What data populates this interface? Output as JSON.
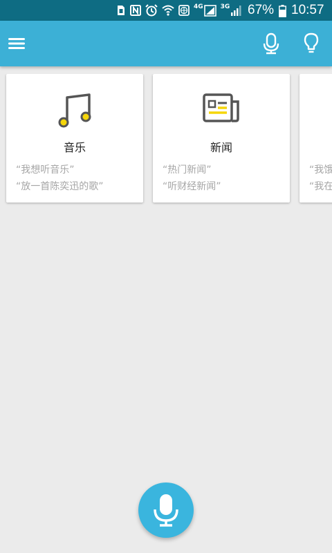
{
  "status_bar": {
    "battery_percent": "67%",
    "time": "10:57",
    "network_label_1": "4G",
    "network_label_2": "3G",
    "icons": [
      "sim-icon",
      "nfc-icon",
      "alarm-icon",
      "wifi-icon",
      "globe-icon",
      "signal-icon",
      "signal-icon",
      "battery-icon"
    ]
  },
  "app_bar": {
    "background_color": "#3cb0d6",
    "icons": [
      "menu-icon",
      "microphone-icon",
      "lightbulb-icon"
    ]
  },
  "cards": [
    {
      "title": "音乐",
      "icon": "music-note-icon",
      "examples": [
        "“我想听音乐”",
        "“放一首陈奕迅的歌”"
      ]
    },
    {
      "title": "新闻",
      "icon": "newspaper-icon",
      "examples": [
        "“热门新闻”",
        "“听财经新闻”"
      ]
    },
    {
      "title": "",
      "icon": "",
      "examples": [
        "“我饿",
        "“我在"
      ]
    }
  ],
  "fab": {
    "icon": "microphone-icon",
    "color": "#3ab5de"
  },
  "colors": {
    "accent_yellow": "#f5d60a",
    "background": "#ebebeb"
  }
}
